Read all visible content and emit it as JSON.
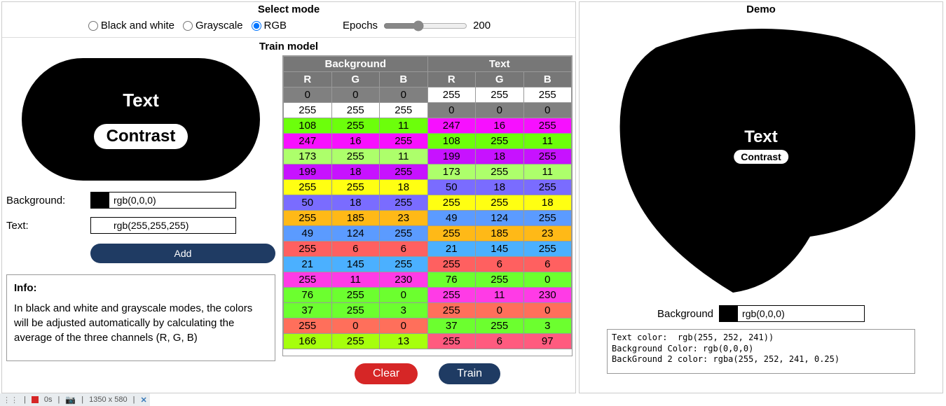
{
  "mode": {
    "header": "Select mode",
    "options": [
      "Black and white",
      "Grayscale",
      "RGB"
    ],
    "selected": 2,
    "epochs_label": "Epochs",
    "epochs_value": "200"
  },
  "train": {
    "header": "Train model",
    "preview": {
      "text": "Text",
      "contrast": "Contrast"
    },
    "bg_label": "Background:",
    "bg_value": "rgb(0,0,0)",
    "bg_swatch": "#000000",
    "text_label": "Text:",
    "text_value": "rgb(255,255,255)",
    "text_swatch": "#ffffff",
    "add": "Add",
    "info_title": "Info:",
    "info_body": "In black and white and grayscale modes, the colors will be adjusted automatically by calculating the average of the three channels (R, G, B)",
    "table": {
      "group_headers": [
        "Background",
        "Text"
      ],
      "sub_headers": [
        "R",
        "G",
        "B",
        "R",
        "G",
        "B"
      ],
      "rows": [
        {
          "bg": [
            0,
            0,
            0
          ],
          "fg": [
            255,
            255,
            255
          ],
          "bgc": "#808080",
          "fgc": "#ffffff"
        },
        {
          "bg": [
            255,
            255,
            255
          ],
          "fg": [
            0,
            0,
            0
          ],
          "bgc": "#ffffff",
          "fgc": "#808080"
        },
        {
          "bg": [
            108,
            255,
            11
          ],
          "fg": [
            247,
            16,
            255
          ],
          "bgc": "#6cff0b",
          "fgc": "#f710ff"
        },
        {
          "bg": [
            247,
            16,
            255
          ],
          "fg": [
            108,
            255,
            11
          ],
          "bgc": "#f710ff",
          "fgc": "#6cff0b"
        },
        {
          "bg": [
            173,
            255,
            11
          ],
          "fg": [
            199,
            18,
            255
          ],
          "bgc": "#adff6b",
          "fgc": "#c712ff"
        },
        {
          "bg": [
            199,
            18,
            255
          ],
          "fg": [
            173,
            255,
            11
          ],
          "bgc": "#c712ff",
          "fgc": "#adff6b"
        },
        {
          "bg": [
            255,
            255,
            18
          ],
          "fg": [
            50,
            18,
            255
          ],
          "bgc": "#ffff12",
          "fgc": "#7a6cff"
        },
        {
          "bg": [
            50,
            18,
            255
          ],
          "fg": [
            255,
            255,
            18
          ],
          "bgc": "#7a6cff",
          "fgc": "#ffff12"
        },
        {
          "bg": [
            255,
            185,
            23
          ],
          "fg": [
            49,
            124,
            255
          ],
          "bgc": "#ffb917",
          "fgc": "#5b9bff"
        },
        {
          "bg": [
            49,
            124,
            255
          ],
          "fg": [
            255,
            185,
            23
          ],
          "bgc": "#5b9bff",
          "fgc": "#ffb917"
        },
        {
          "bg": [
            255,
            6,
            6
          ],
          "fg": [
            21,
            145,
            255
          ],
          "bgc": "#ff6060",
          "fgc": "#4bb0ff"
        },
        {
          "bg": [
            21,
            145,
            255
          ],
          "fg": [
            255,
            6,
            6
          ],
          "bgc": "#4bb0ff",
          "fgc": "#ff6060"
        },
        {
          "bg": [
            255,
            11,
            230
          ],
          "fg": [
            76,
            255,
            0
          ],
          "bgc": "#ff3be6",
          "fgc": "#6cff2f"
        },
        {
          "bg": [
            76,
            255,
            0
          ],
          "fg": [
            255,
            11,
            230
          ],
          "bgc": "#6cff2f",
          "fgc": "#ff3be6"
        },
        {
          "bg": [
            37,
            255,
            3
          ],
          "fg": [
            255,
            0,
            0
          ],
          "bgc": "#6cff2f",
          "fgc": "#ff6f5b"
        },
        {
          "bg": [
            255,
            0,
            0
          ],
          "fg": [
            37,
            255,
            3
          ],
          "bgc": "#ff6f5b",
          "fgc": "#6cff2f"
        },
        {
          "bg": [
            166,
            255,
            13
          ],
          "fg": [
            255,
            6,
            97
          ],
          "bgc": "#a6ff0d",
          "fgc": "#ff5b7f"
        }
      ]
    },
    "clear": "Clear",
    "train_btn": "Train"
  },
  "demo": {
    "header": "Demo",
    "text": "Text",
    "contrast": "Contrast",
    "bg_label": "Background",
    "bg_value": "rgb(0,0,0)",
    "bg_swatch": "#000000",
    "output": "Text color:  rgb(255, 252, 241))\nBackground Color: rgb(0,0,0)\nBackGround 2 color: rgba(255, 252, 241, 0.25)"
  },
  "status": {
    "time": "0s",
    "dims": "1350 x 580"
  }
}
